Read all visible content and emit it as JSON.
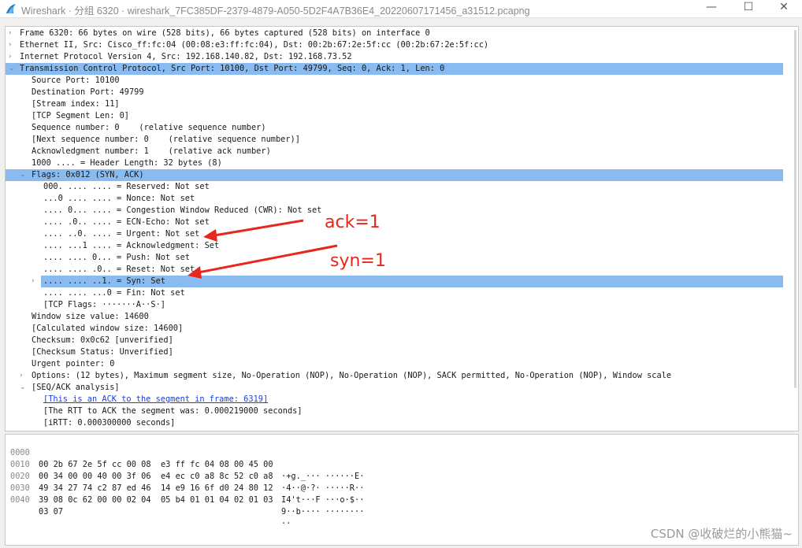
{
  "window": {
    "title": "Wireshark · 分组 6320 · wireshark_7FC385DF-2379-4879-A050-5D2F4A7B36E4_20220607171456_a31512.pcapng",
    "minimize_glyph": "—",
    "maximize_glyph": "☐",
    "close_glyph": "✕"
  },
  "colors": {
    "selected_row": "#89bbf0",
    "annotation": "#e8261c",
    "link": "#1c3fe0"
  },
  "tree": [
    {
      "twisty": "›",
      "text": "Frame 6320: 66 bytes on wire (528 bits), 66 bytes captured (528 bits) on interface 0"
    },
    {
      "twisty": "›",
      "text": "Ethernet II, Src: Cisco_ff:fc:04 (00:08:e3:ff:fc:04), Dst: 00:2b:67:2e:5f:cc (00:2b:67:2e:5f:cc)"
    },
    {
      "twisty": "›",
      "text": "Internet Protocol Version 4, Src: 192.168.140.82, Dst: 192.168.73.52"
    },
    {
      "twisty": "⌄",
      "text": "Transmission Control Protocol, Src Port: 10100, Dst Port: 49799, Seq: 0, Ack: 1, Len: 0"
    },
    {
      "twisty": "",
      "text": "Source Port: 10100"
    },
    {
      "twisty": "",
      "text": "Destination Port: 49799"
    },
    {
      "twisty": "",
      "text": "[Stream index: 11]"
    },
    {
      "twisty": "",
      "text": "[TCP Segment Len: 0]"
    },
    {
      "twisty": "",
      "text": "Sequence number: 0    (relative sequence number)"
    },
    {
      "twisty": "",
      "text": "[Next sequence number: 0    (relative sequence number)]"
    },
    {
      "twisty": "",
      "text": "Acknowledgment number: 1    (relative ack number)"
    },
    {
      "twisty": "",
      "text": "1000 .... = Header Length: 32 bytes (8)"
    },
    {
      "twisty": "⌄",
      "text": "Flags: 0x012 (SYN, ACK)"
    },
    {
      "twisty": "",
      "text": "000. .... .... = Reserved: Not set"
    },
    {
      "twisty": "",
      "text": "...0 .... .... = Nonce: Not set"
    },
    {
      "twisty": "",
      "text": ".... 0... .... = Congestion Window Reduced (CWR): Not set"
    },
    {
      "twisty": "",
      "text": ".... .0.. .... = ECN-Echo: Not set"
    },
    {
      "twisty": "",
      "text": ".... ..0. .... = Urgent: Not set"
    },
    {
      "twisty": "",
      "text": ".... ...1 .... = Acknowledgment: Set"
    },
    {
      "twisty": "",
      "text": ".... .... 0... = Push: Not set"
    },
    {
      "twisty": "",
      "text": ".... .... .0.. = Reset: Not set"
    },
    {
      "twisty": "›",
      "text": ".... .... ..1. = Syn: Set"
    },
    {
      "twisty": "",
      "text": ".... .... ...0 = Fin: Not set"
    },
    {
      "twisty": "",
      "text": "[TCP Flags: ·······A··S·]"
    },
    {
      "twisty": "",
      "text": "Window size value: 14600"
    },
    {
      "twisty": "",
      "text": "[Calculated window size: 14600]"
    },
    {
      "twisty": "",
      "text": "Checksum: 0x0c62 [unverified]"
    },
    {
      "twisty": "",
      "text": "[Checksum Status: Unverified]"
    },
    {
      "twisty": "",
      "text": "Urgent pointer: 0"
    },
    {
      "twisty": "›",
      "text": "Options: (12 bytes), Maximum segment size, No-Operation (NOP), No-Operation (NOP), SACK permitted, No-Operation (NOP), Window scale"
    },
    {
      "twisty": "⌄",
      "text": "[SEQ/ACK analysis]"
    },
    {
      "twisty": "",
      "text": "[This is an ACK to the segment in frame: 6319]"
    },
    {
      "twisty": "",
      "text": "[The RTT to ACK the segment was: 0.000219000 seconds]"
    },
    {
      "twisty": "",
      "text": "[iRTT: 0.000300000 seconds]"
    }
  ],
  "hex": [
    {
      "offset": "0000",
      "bytes": "00 2b 67 2e 5f cc 00 08  e3 ff fc 04 08 00 45 00",
      "ascii": "·+g._··· ······E·"
    },
    {
      "offset": "0010",
      "bytes": "00 34 00 00 40 00 3f 06  e4 ec c0 a8 8c 52 c0 a8",
      "ascii": "·4··@·?· ·····R··"
    },
    {
      "offset": "0020",
      "bytes": "49 34 27 74 c2 87 ed 46  14 e9 16 6f d0 24 80 12",
      "ascii": "I4't···F ···o·$··"
    },
    {
      "offset": "0030",
      "bytes": "39 08 0c 62 00 00 02 04  05 b4 01 01 04 02 01 03",
      "ascii": "9··b···· ········"
    },
    {
      "offset": "0040",
      "bytes": "03 07",
      "ascii": "··"
    }
  ],
  "annotations": {
    "ack": "ack=1",
    "syn": "syn=1"
  },
  "watermark": "CSDN @收破烂的小熊猫~"
}
